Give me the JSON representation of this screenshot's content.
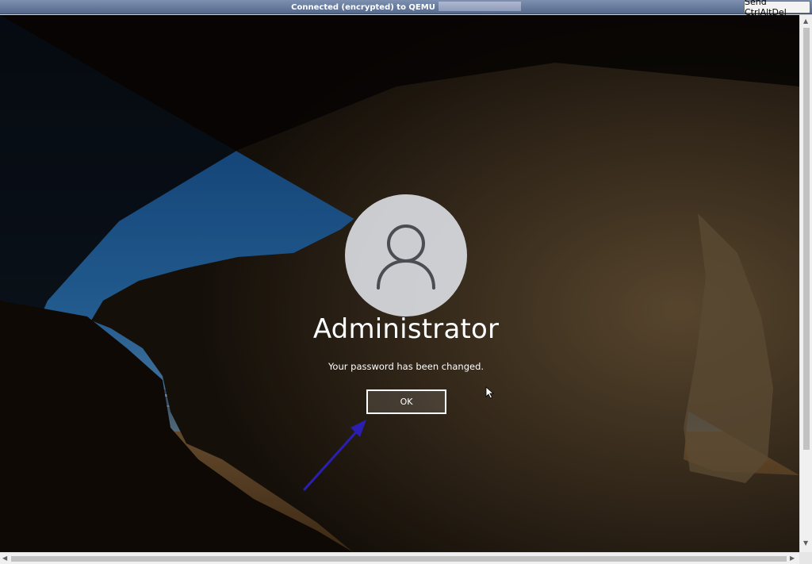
{
  "console": {
    "title": "Connected (encrypted) to QEMU",
    "send_cad_label": "Send CtrlAltDel"
  },
  "login": {
    "username": "Administrator",
    "message": "Your password has been changed.",
    "ok_label": "OK",
    "avatar_icon": "user-icon"
  },
  "colors": {
    "annotation_arrow": "#2a1fb0",
    "button_border": "#ffffff",
    "topbar": "#6a7ea2"
  },
  "scroll": {
    "up_glyph": "▲",
    "down_glyph": "▼",
    "left_glyph": "◀",
    "right_glyph": "▶"
  }
}
